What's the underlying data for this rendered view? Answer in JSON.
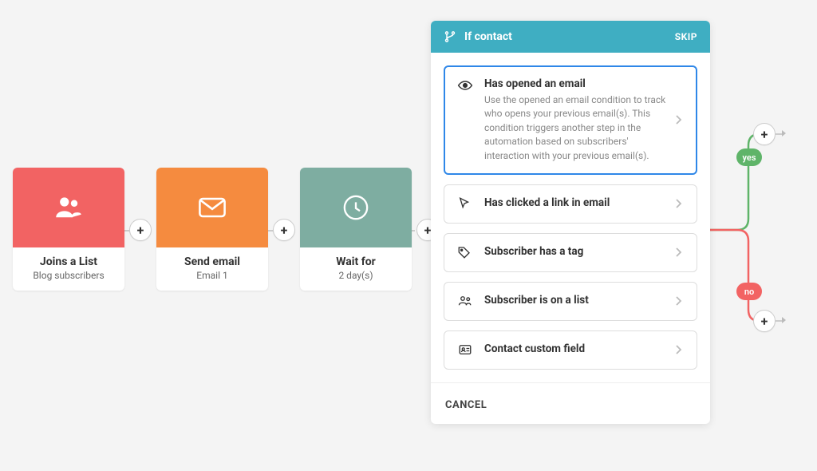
{
  "flow": {
    "start": {
      "title": "Joins a List",
      "subtitle": "Blog subscribers"
    },
    "email": {
      "title": "Send email",
      "subtitle": "Email 1"
    },
    "wait": {
      "title": "Wait for",
      "subtitle": "2 day(s)"
    }
  },
  "branches": {
    "yes": "yes",
    "no": "no"
  },
  "panel": {
    "title": "If contact",
    "skip": "SKIP",
    "cancel": "CANCEL",
    "options": [
      {
        "title": "Has opened an email",
        "desc": "Use the opened an email condition to track who opens your previous email(s). This condition triggers another step in the automation based on subscribers' interaction with your previous email(s)."
      },
      {
        "title": "Has clicked a link in email"
      },
      {
        "title": "Subscriber has a tag"
      },
      {
        "title": "Subscriber is on a list"
      },
      {
        "title": "Contact custom field"
      }
    ]
  },
  "glyphs": {
    "plus": "+"
  }
}
